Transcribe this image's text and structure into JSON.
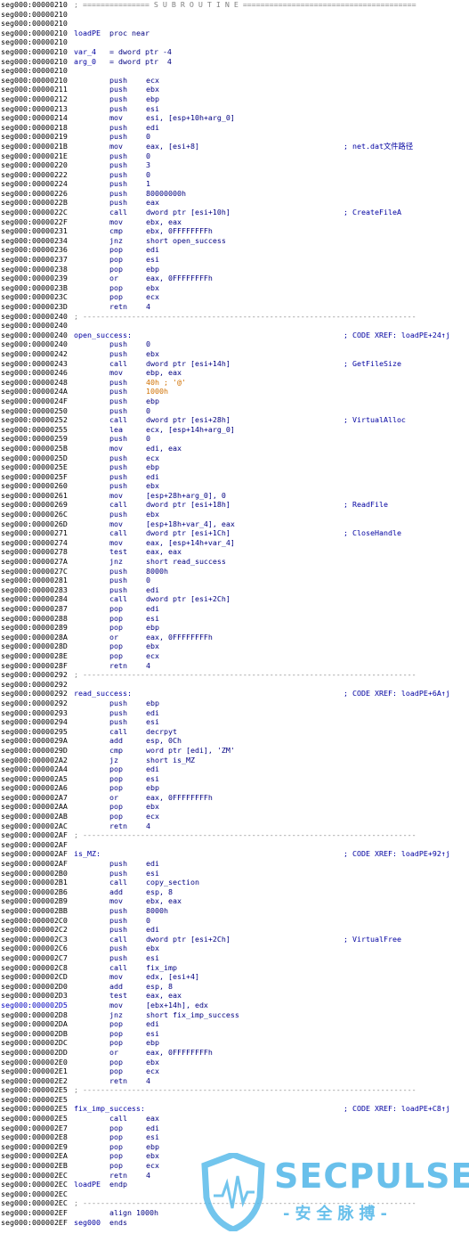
{
  "lines": [
    {
      "s": "seg000:00000210",
      "sep": "; =============== S U B R O U T I N E ======================================="
    },
    {
      "s": "seg000:00000210"
    },
    {
      "s": "seg000:00000210"
    },
    {
      "s": "seg000:00000210",
      "l": "loadPE",
      "m": "proc near"
    },
    {
      "s": "seg000:00000210"
    },
    {
      "s": "seg000:00000210",
      "l": "var_4",
      "m": "= dword ptr -4"
    },
    {
      "s": "seg000:00000210",
      "l": "arg_0",
      "m": "= dword ptr  4"
    },
    {
      "s": "seg000:00000210"
    },
    {
      "s": "seg000:00000210",
      "m": "push",
      "o": "ecx"
    },
    {
      "s": "seg000:00000211",
      "m": "push",
      "o": "ebx"
    },
    {
      "s": "seg000:00000212",
      "m": "push",
      "o": "ebp"
    },
    {
      "s": "seg000:00000213",
      "m": "push",
      "o": "esi"
    },
    {
      "s": "seg000:00000214",
      "m": "mov",
      "o": "esi, [esp+10h+arg_0]"
    },
    {
      "s": "seg000:00000218",
      "m": "push",
      "o": "edi"
    },
    {
      "s": "seg000:00000219",
      "m": "push",
      "o": "0"
    },
    {
      "s": "seg000:0000021B",
      "m": "mov",
      "o": "eax, [esi+8]",
      "c": "; net.dat文件路径"
    },
    {
      "s": "seg000:0000021E",
      "m": "push",
      "o": "0"
    },
    {
      "s": "seg000:00000220",
      "m": "push",
      "o": "3"
    },
    {
      "s": "seg000:00000222",
      "m": "push",
      "o": "0"
    },
    {
      "s": "seg000:00000224",
      "m": "push",
      "o": "1"
    },
    {
      "s": "seg000:00000226",
      "m": "push",
      "o": "80000000h"
    },
    {
      "s": "seg000:0000022B",
      "m": "push",
      "o": "eax"
    },
    {
      "s": "seg000:0000022C",
      "m": "call",
      "o": "dword ptr [esi+10h]",
      "c": "; CreateFileA"
    },
    {
      "s": "seg000:0000022F",
      "m": "mov",
      "o": "ebx, eax"
    },
    {
      "s": "seg000:00000231",
      "m": "cmp",
      "o": "ebx, 0FFFFFFFFh"
    },
    {
      "s": "seg000:00000234",
      "m": "jnz",
      "o": "short open_success"
    },
    {
      "s": "seg000:00000236",
      "m": "pop",
      "o": "edi"
    },
    {
      "s": "seg000:00000237",
      "m": "pop",
      "o": "esi"
    },
    {
      "s": "seg000:00000238",
      "m": "pop",
      "o": "ebp"
    },
    {
      "s": "seg000:00000239",
      "m": "or",
      "o": "eax, 0FFFFFFFFh"
    },
    {
      "s": "seg000:0000023B",
      "m": "pop",
      "o": "ebx"
    },
    {
      "s": "seg000:0000023C",
      "m": "pop",
      "o": "ecx"
    },
    {
      "s": "seg000:0000023D",
      "m": "retn",
      "o": "4"
    },
    {
      "s": "seg000:00000240",
      "sep": "; ---------------------------------------------------------------------------"
    },
    {
      "s": "seg000:00000240"
    },
    {
      "s": "seg000:00000240",
      "l": "open_success:",
      "c": "; CODE XREF: loadPE+24↑j"
    },
    {
      "s": "seg000:00000240",
      "m": "push",
      "o": "0"
    },
    {
      "s": "seg000:00000242",
      "m": "push",
      "o": "ebx"
    },
    {
      "s": "seg000:00000243",
      "m": "call",
      "o": "dword ptr [esi+14h]",
      "c": "; GetFileSize"
    },
    {
      "s": "seg000:00000246",
      "m": "mov",
      "o": "ebp, eax"
    },
    {
      "s": "seg000:00000248",
      "m": "push",
      "o": "40h ; '@'",
      "oc": "orange"
    },
    {
      "s": "seg000:0000024A",
      "m": "push",
      "o": "1000h",
      "oc": "orange"
    },
    {
      "s": "seg000:0000024F",
      "m": "push",
      "o": "ebp"
    },
    {
      "s": "seg000:00000250",
      "m": "push",
      "o": "0"
    },
    {
      "s": "seg000:00000252",
      "m": "call",
      "o": "dword ptr [esi+28h]",
      "c": "; VirtualAlloc"
    },
    {
      "s": "seg000:00000255",
      "m": "lea",
      "o": "ecx, [esp+14h+arg_0]"
    },
    {
      "s": "seg000:00000259",
      "m": "push",
      "o": "0"
    },
    {
      "s": "seg000:0000025B",
      "m": "mov",
      "o": "edi, eax"
    },
    {
      "s": "seg000:0000025D",
      "m": "push",
      "o": "ecx"
    },
    {
      "s": "seg000:0000025E",
      "m": "push",
      "o": "ebp"
    },
    {
      "s": "seg000:0000025F",
      "m": "push",
      "o": "edi"
    },
    {
      "s": "seg000:00000260",
      "m": "push",
      "o": "ebx"
    },
    {
      "s": "seg000:00000261",
      "m": "mov",
      "o": "[esp+28h+arg_0], 0"
    },
    {
      "s": "seg000:00000269",
      "m": "call",
      "o": "dword ptr [esi+18h]",
      "c": "; ReadFile"
    },
    {
      "s": "seg000:0000026C",
      "m": "push",
      "o": "ebx"
    },
    {
      "s": "seg000:0000026D",
      "m": "mov",
      "o": "[esp+18h+var_4], eax"
    },
    {
      "s": "seg000:00000271",
      "m": "call",
      "o": "dword ptr [esi+1Ch]",
      "c": "; CloseHandle"
    },
    {
      "s": "seg000:00000274",
      "m": "mov",
      "o": "eax, [esp+14h+var_4]"
    },
    {
      "s": "seg000:00000278",
      "m": "test",
      "o": "eax, eax"
    },
    {
      "s": "seg000:0000027A",
      "m": "jnz",
      "o": "short read_success"
    },
    {
      "s": "seg000:0000027C",
      "m": "push",
      "o": "8000h"
    },
    {
      "s": "seg000:00000281",
      "m": "push",
      "o": "0"
    },
    {
      "s": "seg000:00000283",
      "m": "push",
      "o": "edi"
    },
    {
      "s": "seg000:00000284",
      "m": "call",
      "o": "dword ptr [esi+2Ch]"
    },
    {
      "s": "seg000:00000287",
      "m": "pop",
      "o": "edi"
    },
    {
      "s": "seg000:00000288",
      "m": "pop",
      "o": "esi"
    },
    {
      "s": "seg000:00000289",
      "m": "pop",
      "o": "ebp"
    },
    {
      "s": "seg000:0000028A",
      "m": "or",
      "o": "eax, 0FFFFFFFFh"
    },
    {
      "s": "seg000:0000028D",
      "m": "pop",
      "o": "ebx"
    },
    {
      "s": "seg000:0000028E",
      "m": "pop",
      "o": "ecx"
    },
    {
      "s": "seg000:0000028F",
      "m": "retn",
      "o": "4"
    },
    {
      "s": "seg000:00000292",
      "sep": "; ---------------------------------------------------------------------------"
    },
    {
      "s": "seg000:00000292"
    },
    {
      "s": "seg000:00000292",
      "l": "read_success:",
      "c": "; CODE XREF: loadPE+6A↑j"
    },
    {
      "s": "seg000:00000292",
      "m": "push",
      "o": "ebp"
    },
    {
      "s": "seg000:00000293",
      "m": "push",
      "o": "edi"
    },
    {
      "s": "seg000:00000294",
      "m": "push",
      "o": "esi"
    },
    {
      "s": "seg000:00000295",
      "m": "call",
      "o": "decrpyt"
    },
    {
      "s": "seg000:0000029A",
      "m": "add",
      "o": "esp, 0Ch"
    },
    {
      "s": "seg000:0000029D",
      "m": "cmp",
      "o": "word ptr [edi], 'ZM'"
    },
    {
      "s": "seg000:000002A2",
      "m": "jz",
      "o": "short is_MZ"
    },
    {
      "s": "seg000:000002A4",
      "m": "pop",
      "o": "edi"
    },
    {
      "s": "seg000:000002A5",
      "m": "pop",
      "o": "esi"
    },
    {
      "s": "seg000:000002A6",
      "m": "pop",
      "o": "ebp"
    },
    {
      "s": "seg000:000002A7",
      "m": "or",
      "o": "eax, 0FFFFFFFFh"
    },
    {
      "s": "seg000:000002AA",
      "m": "pop",
      "o": "ebx"
    },
    {
      "s": "seg000:000002AB",
      "m": "pop",
      "o": "ecx"
    },
    {
      "s": "seg000:000002AC",
      "m": "retn",
      "o": "4"
    },
    {
      "s": "seg000:000002AF",
      "sep": "; ---------------------------------------------------------------------------"
    },
    {
      "s": "seg000:000002AF"
    },
    {
      "s": "seg000:000002AF",
      "l": "is_MZ:",
      "c": "; CODE XREF: loadPE+92↑j"
    },
    {
      "s": "seg000:000002AF",
      "m": "push",
      "o": "edi"
    },
    {
      "s": "seg000:000002B0",
      "m": "push",
      "o": "esi"
    },
    {
      "s": "seg000:000002B1",
      "m": "call",
      "o": "copy_section"
    },
    {
      "s": "seg000:000002B6",
      "m": "add",
      "o": "esp, 8"
    },
    {
      "s": "seg000:000002B9",
      "m": "mov",
      "o": "ebx, eax"
    },
    {
      "s": "seg000:000002BB",
      "m": "push",
      "o": "8000h"
    },
    {
      "s": "seg000:000002C0",
      "m": "push",
      "o": "0"
    },
    {
      "s": "seg000:000002C2",
      "m": "push",
      "o": "edi"
    },
    {
      "s": "seg000:000002C3",
      "m": "call",
      "o": "dword ptr [esi+2Ch]",
      "c": "; VirtualFree"
    },
    {
      "s": "seg000:000002C6",
      "m": "push",
      "o": "ebx"
    },
    {
      "s": "seg000:000002C7",
      "m": "push",
      "o": "esi"
    },
    {
      "s": "seg000:000002C8",
      "m": "call",
      "o": "fix_imp"
    },
    {
      "s": "seg000:000002CD",
      "m": "mov",
      "o": "edx, [esi+4]"
    },
    {
      "s": "seg000:000002D0",
      "m": "add",
      "o": "esp, 8"
    },
    {
      "s": "seg000:000002D3",
      "m": "test",
      "o": "eax, eax"
    },
    {
      "s": "seg000:000002D5",
      "m": "mov",
      "o": "[ebx+14h], edx",
      "sc": "blue"
    },
    {
      "s": "seg000:000002D8",
      "m": "jnz",
      "o": "short fix_imp_success"
    },
    {
      "s": "seg000:000002DA",
      "m": "pop",
      "o": "edi"
    },
    {
      "s": "seg000:000002DB",
      "m": "pop",
      "o": "esi"
    },
    {
      "s": "seg000:000002DC",
      "m": "pop",
      "o": "ebp"
    },
    {
      "s": "seg000:000002DD",
      "m": "or",
      "o": "eax, 0FFFFFFFFh"
    },
    {
      "s": "seg000:000002E0",
      "m": "pop",
      "o": "ebx"
    },
    {
      "s": "seg000:000002E1",
      "m": "pop",
      "o": "ecx"
    },
    {
      "s": "seg000:000002E2",
      "m": "retn",
      "o": "4"
    },
    {
      "s": "seg000:000002E5",
      "sep": "; ---------------------------------------------------------------------------"
    },
    {
      "s": "seg000:000002E5"
    },
    {
      "s": "seg000:000002E5",
      "l": "fix_imp_success:",
      "c": "; CODE XREF: loadPE+C8↑j"
    },
    {
      "s": "seg000:000002E5",
      "m": "call",
      "o": "eax"
    },
    {
      "s": "seg000:000002E7",
      "m": "pop",
      "o": "edi"
    },
    {
      "s": "seg000:000002E8",
      "m": "pop",
      "o": "esi"
    },
    {
      "s": "seg000:000002E9",
      "m": "pop",
      "o": "ebp"
    },
    {
      "s": "seg000:000002EA",
      "m": "pop",
      "o": "ebx"
    },
    {
      "s": "seg000:000002EB",
      "m": "pop",
      "o": "ecx"
    },
    {
      "s": "seg000:000002EC",
      "m": "retn",
      "o": "4"
    },
    {
      "s": "seg000:000002EC",
      "l": "loadPE",
      "m": "endp"
    },
    {
      "s": "seg000:000002EC"
    },
    {
      "s": "seg000:000002EC",
      "sep": "; ---------------------------------------------------------------------------"
    },
    {
      "s": "seg000:000002EF",
      "m": "align 1000h"
    },
    {
      "s": "seg000:000002EF",
      "l": "seg000",
      "m": "ends"
    }
  ],
  "watermark": {
    "brand": "SECPULSE",
    "sub": "-安全脉搏-",
    "color": "#4fb6e8"
  }
}
